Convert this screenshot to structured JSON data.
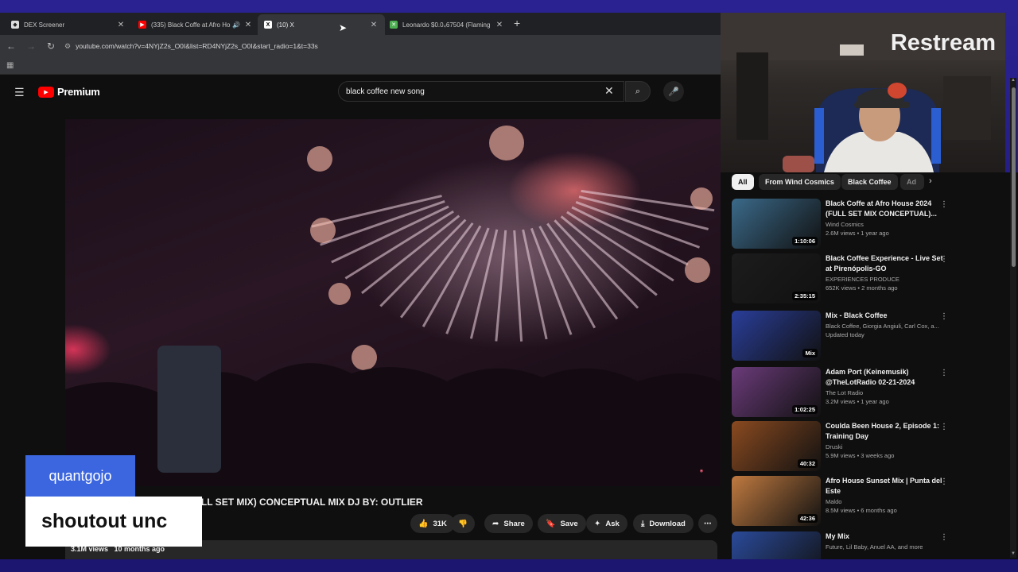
{
  "browser": {
    "tabs": [
      {
        "title": "DEX Screener",
        "favicon": "dex-icon",
        "active": false
      },
      {
        "title": "(335) Black Coffe at Afro Ho",
        "favicon": "youtube-icon",
        "active": false,
        "audio": true
      },
      {
        "title": "(10) X",
        "favicon": "x-icon",
        "active": true
      },
      {
        "title": "Leonardo $0.0₄67504 (Flaming",
        "favicon": "green-x-icon",
        "active": false
      }
    ],
    "url": "youtube.com/watch?v=4NYjZ2s_O0I&list=RD4NYjZ2s_O0I&start_radio=1&t=33s"
  },
  "youtube": {
    "brand": "Premium",
    "search_value": "black coffee new song",
    "video": {
      "title": "Black Coffe at Afro House (FULL SET MIX) CONCEPTUAL MIX DJ BY: OUTLIER",
      "views": "3.1M views",
      "age": "10 months ago",
      "likes": "31K",
      "actions": {
        "share": "Share",
        "save": "Save",
        "ask": "Ask",
        "download": "Download"
      }
    },
    "chips": [
      "All",
      "From Wind Cosmics",
      "Black Coffee",
      "Ad"
    ],
    "recommendations": [
      {
        "title": "Black Coffe at Afro House 2024 (FULL SET MIX CONCEPTUAL)...",
        "channel": "Wind Cosmics",
        "meta": "2.6M views • 1 year ago",
        "duration": "1:10:06",
        "thumb": "#3b6a8a"
      },
      {
        "title": "Black Coffee Experience - Live Set at Pirenópolis-GO",
        "channel": "EXPERIENCES PRODUCE",
        "meta": "652K views • 2 months ago",
        "duration": "2:35:15",
        "thumb": "#1c1c1c"
      },
      {
        "title": "Mix - Black Coffee",
        "channel": "Black Coffee, Giorgia Angiuli, Carl Cox, a...",
        "meta": "Updated today",
        "duration": "Mix",
        "thumb": "#2a3e9a"
      },
      {
        "title": "Adam Port (Keinemusik) @TheLotRadio 02-21-2024",
        "channel": "The Lot Radio",
        "meta": "3.2M views • 1 year ago",
        "duration": "1:02:25",
        "thumb": "#6b3b7a"
      },
      {
        "title": "Coulda Been House 2, Episode 1: Training Day",
        "channel": "Druski",
        "meta": "5.9M views • 3 weeks ago",
        "duration": "40:32",
        "thumb": "#8a4a20"
      },
      {
        "title": "Afro House Sunset Mix | Punta del Este",
        "channel": "Maldo",
        "meta": "8.5M views • 6 months ago",
        "duration": "42:36",
        "thumb": "#c07a40"
      },
      {
        "title": "My Mix",
        "channel": "Future, Lil Baby, Anuel AA, and more",
        "meta": "",
        "duration": "",
        "thumb": "#2a4a9a"
      }
    ]
  },
  "overlay": {
    "username": "quantgojo",
    "message": "shoutout unc"
  },
  "webcam": {
    "logo": "Restream"
  },
  "colors": {
    "yt_red": "#ff0000",
    "overlay_blue": "#3b66e0",
    "frame": "#1c1670"
  }
}
